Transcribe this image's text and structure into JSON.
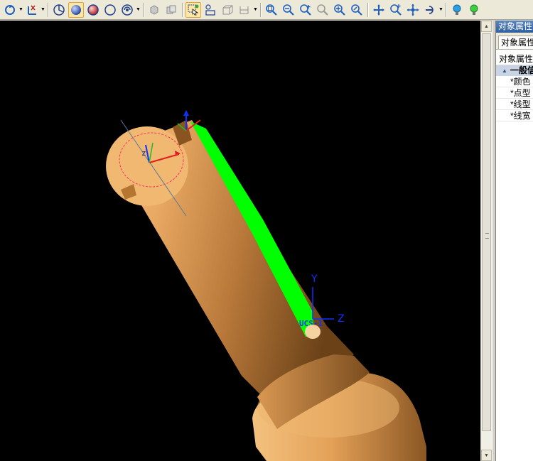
{
  "toolbar": {
    "buttons": [
      {
        "id": "rotate",
        "icon": "rotate-view-icon"
      },
      {
        "id": "ucs",
        "icon": "ucs-axis-icon"
      },
      {
        "id": "wireframe",
        "icon": "wireframe-shade-icon"
      },
      {
        "id": "shaded",
        "icon": "shaded-sphere-icon",
        "active": true
      },
      {
        "id": "shaded-edges",
        "icon": "shaded-edges-sphere-icon"
      },
      {
        "id": "hidden-line",
        "icon": "hidden-line-sphere-icon"
      },
      {
        "id": "render-mode",
        "icon": "render-mode-icon"
      },
      {
        "id": "select-filter",
        "icon": "select-filter-icon",
        "active": true
      },
      {
        "id": "zoom-in",
        "icon": "zoom-in-icon"
      },
      {
        "id": "zoom-out",
        "icon": "zoom-out-icon"
      },
      {
        "id": "pan",
        "icon": "pan-icon"
      },
      {
        "id": "show",
        "icon": "lightbulb-on-icon"
      },
      {
        "id": "hide",
        "icon": "lightbulb-green-icon"
      }
    ],
    "colors": {
      "bar": "#ece9d8",
      "active_bg": "#ffe8a6",
      "icon_blue": "#1f5fbf"
    }
  },
  "viewport": {
    "ucs_label": "UCS-1",
    "axis_y": "Y",
    "axis_z": "Z",
    "axis_small_z": "z",
    "colors": {
      "background": "#000000",
      "part": "#e0a25a",
      "highlight": "#00ff00"
    }
  },
  "panel": {
    "title": "对象属性",
    "tab": "对象属性",
    "header": "对象属性",
    "group": "一般信",
    "rows": [
      "*颜色",
      "*点型",
      "*线型",
      "*线宽"
    ]
  }
}
